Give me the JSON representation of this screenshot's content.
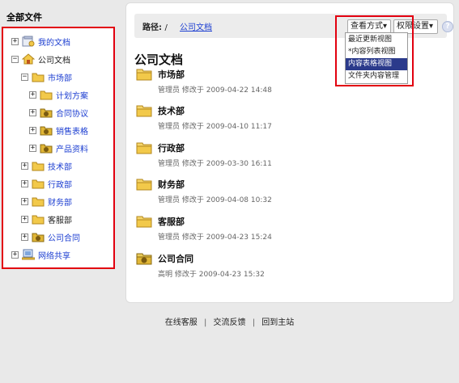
{
  "tree": {
    "header": "全部文件",
    "nodes": [
      {
        "label": "我的文档",
        "toggle": "+",
        "icon": "my-docs-icon",
        "style": "link"
      },
      {
        "label": "公司文档",
        "toggle": "−",
        "icon": "house-icon",
        "style": "plain"
      },
      {
        "label": "市场部",
        "toggle": "−",
        "icon": "folder-icon",
        "style": "link"
      },
      {
        "label": "计划方案",
        "toggle": "+",
        "icon": "folder-icon",
        "style": "link"
      },
      {
        "label": "合同协议",
        "toggle": "+",
        "icon": "special-folder-icon",
        "style": "link"
      },
      {
        "label": "销售表格",
        "toggle": "+",
        "icon": "special-folder-icon",
        "style": "link"
      },
      {
        "label": "产品资料",
        "toggle": "+",
        "icon": "special-folder-icon",
        "style": "link"
      },
      {
        "label": "技术部",
        "toggle": "+",
        "icon": "folder-icon",
        "style": "link"
      },
      {
        "label": "行政部",
        "toggle": "+",
        "icon": "folder-icon",
        "style": "link"
      },
      {
        "label": "财务部",
        "toggle": "+",
        "icon": "folder-icon",
        "style": "link"
      },
      {
        "label": "客服部",
        "toggle": "+",
        "icon": "folder-icon",
        "style": "plain"
      },
      {
        "label": "公司合同",
        "toggle": "+",
        "icon": "special-folder-icon",
        "style": "link"
      },
      {
        "label": "网络共享",
        "toggle": "+",
        "icon": "network-share-icon",
        "style": "link"
      }
    ]
  },
  "pathbar": {
    "label": "路径:",
    "separator": "/",
    "current": "公司文档",
    "view_button": "查看方式▾",
    "perm_button": "权限设置▾",
    "help_icon": "?"
  },
  "view_menu": {
    "items": [
      "最近更新视图",
      "*内容列表视图",
      "内容表格视图",
      "文件夹内容管理"
    ],
    "selected_index": 2
  },
  "main": {
    "title": "公司文档",
    "folders": [
      {
        "name": "市场部",
        "meta": "管理员 修改于 2009-04-22 14:48",
        "icon": "folder-icon"
      },
      {
        "name": "技术部",
        "meta": "管理员 修改于 2009-04-10 11:17",
        "icon": "folder-icon"
      },
      {
        "name": "行政部",
        "meta": "管理员 修改于 2009-03-30 16:11",
        "icon": "folder-icon"
      },
      {
        "name": "财务部",
        "meta": "管理员 修改于 2009-04-08 10:32",
        "icon": "folder-icon"
      },
      {
        "name": "客服部",
        "meta": "管理员 修改于 2009-04-23 15:24",
        "icon": "folder-icon"
      },
      {
        "name": "公司合同",
        "meta": "高明 修改于 2009-04-23 15:32",
        "icon": "special-folder-icon"
      }
    ]
  },
  "footer": {
    "links": [
      "在线客服",
      "交流反馈",
      "回到主站"
    ],
    "separator": "|"
  },
  "colors": {
    "highlight_border": "#e2000f",
    "link": "#1c3ed1",
    "menu_selected": "#2b3a8b",
    "folder": "#f2c94a"
  }
}
